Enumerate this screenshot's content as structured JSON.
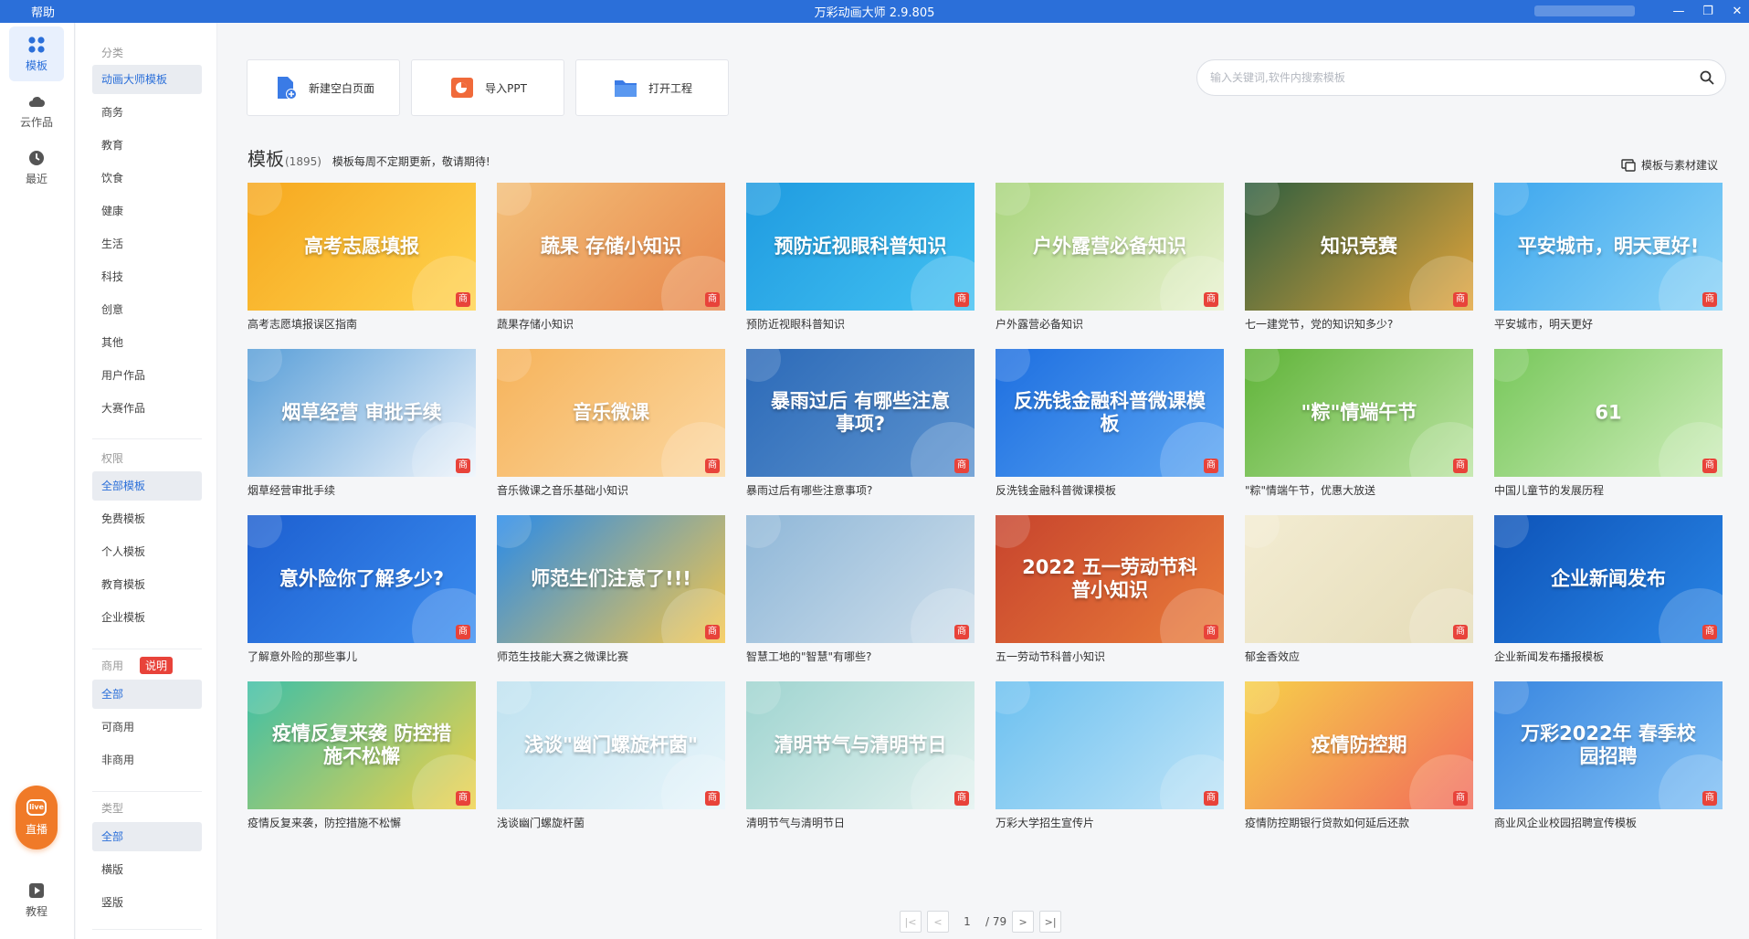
{
  "titlebar": {
    "menu": "帮助",
    "title": "万彩动画大师 2.9.805"
  },
  "rail": {
    "items": [
      {
        "label": "模板",
        "icon": "grid-icon",
        "active": true
      },
      {
        "label": "云作品",
        "icon": "cloud-icon",
        "active": false
      },
      {
        "label": "最近",
        "icon": "clock-icon",
        "active": false
      }
    ],
    "live_label": "直播",
    "live_icon_text": "live",
    "tutorial_label": "教程"
  },
  "filters": {
    "category_head": "分类",
    "categories": [
      "动画大师模板",
      "商务",
      "教育",
      "饮食",
      "健康",
      "生活",
      "科技",
      "创意",
      "其他",
      "用户作品",
      "大赛作品"
    ],
    "permission_head": "权限",
    "permissions": [
      "全部模板",
      "免费模板",
      "个人模板",
      "教育模板",
      "企业模板"
    ],
    "commercial_head": "商用",
    "commercial_note": "说明",
    "commercial": [
      "全部",
      "可商用",
      "非商用"
    ],
    "type_head": "类型",
    "types": [
      "全部",
      "横版",
      "竖版"
    ]
  },
  "actions": {
    "new_blank": "新建空白页面",
    "import_ppt": "导入PPT",
    "open_project": "打开工程"
  },
  "search": {
    "placeholder": "输入关键词,软件内搜索模板"
  },
  "section": {
    "title": "模板",
    "count": "(1895)",
    "tip": "模板每周不定期更新，敬请期待!",
    "suggest": "模板与素材建议"
  },
  "badge_text": "商",
  "templates": [
    {
      "name": "高考志愿填报误区指南",
      "caption": "高考志愿填报",
      "bg": "#f6a81f",
      "bg2": "#ffd34d"
    },
    {
      "name": "蔬果存储小知识",
      "caption": "蔬果 存储小知识",
      "bg": "#f3c07a",
      "bg2": "#e8864a"
    },
    {
      "name": "预防近视眼科普知识",
      "caption": "预防近视眼科普知识",
      "bg": "#1f9be0",
      "bg2": "#43c1f2"
    },
    {
      "name": "户外露营必备知识",
      "caption": "户外露营必备知识",
      "bg": "#a8d47c",
      "bg2": "#e9f2d0"
    },
    {
      "name": "七一建党节，党的知识知多少?",
      "caption": "知识竞赛",
      "bg": "#2f5e3f",
      "bg2": "#e2a43a"
    },
    {
      "name": "平安城市，明天更好",
      "caption": "平安城市，明天更好!",
      "bg": "#3ea7ee",
      "bg2": "#8ad3f7"
    },
    {
      "name": "烟草经营审批手续",
      "caption": "烟草经营 审批手续",
      "bg": "#5a9fd8",
      "bg2": "#eef4fb"
    },
    {
      "name": "音乐微课之音乐基础小知识",
      "caption": "音乐微课",
      "bg": "#f6b35b",
      "bg2": "#fbd7a0"
    },
    {
      "name": "暴雨过后有哪些注意事项?",
      "caption": "暴雨过后 有哪些注意事项?",
      "bg": "#2c6ab8",
      "bg2": "#5c93cf"
    },
    {
      "name": "反洗钱金融科普微课模板",
      "caption": "反洗钱金融科普微课模板",
      "bg": "#1e6fe0",
      "bg2": "#5aa5f3"
    },
    {
      "name": "\"粽\"情端午节，优惠大放送",
      "caption": "\"粽\"情端午节",
      "bg": "#5fb338",
      "bg2": "#bce4a3"
    },
    {
      "name": "中国儿童节的发展历程",
      "caption": "61",
      "bg": "#77c75a",
      "bg2": "#cfeebc"
    },
    {
      "name": "了解意外险的那些事儿",
      "caption": "意外险你了解多少?",
      "bg": "#1d5fd0",
      "bg2": "#3c8ef0"
    },
    {
      "name": "师范生技能大赛之微课比赛",
      "caption": "师范生们注意了!!!",
      "bg": "#2a8be8",
      "bg2": "#f5c64a"
    },
    {
      "name": "智慧工地的\"智慧\"有哪些?",
      "caption": "",
      "bg": "#8fb7d8",
      "bg2": "#cfdfeb"
    },
    {
      "name": "五一劳动节科普小知识",
      "caption": "2022 五一劳动节科普小知识",
      "bg": "#c7442d",
      "bg2": "#e97c3a"
    },
    {
      "name": "郁金香效应",
      "caption": "",
      "bg": "#f3ecd2",
      "bg2": "#e5dcb8"
    },
    {
      "name": "企业新闻发布播报模板",
      "caption": "企业新闻发布",
      "bg": "#0d53b8",
      "bg2": "#2a86e6"
    },
    {
      "name": "疫情反复来袭，防控措施不松懈",
      "caption": "疫情反复来袭 防控措施不松懈",
      "bg": "#3fbfa6",
      "bg2": "#f0d148"
    },
    {
      "name": "浅谈幽门螺旋杆菌",
      "caption": "浅谈\"幽门螺旋杆菌\"",
      "bg": "#bfe2f0",
      "bg2": "#e8f5fa"
    },
    {
      "name": "清明节气与清明节日",
      "caption": "清明节气与清明节日",
      "bg": "#9fd4d0",
      "bg2": "#e3f2ef"
    },
    {
      "name": "万彩大学招生宣传片",
      "caption": "",
      "bg": "#6cc0f0",
      "bg2": "#bfe4f7"
    },
    {
      "name": "疫情防控期银行贷款如何延后还款",
      "caption": "疫情防控期",
      "bg": "#f6d04a",
      "bg2": "#f26a5a"
    },
    {
      "name": "商业风企业校园招聘宣传模板",
      "caption": "万彩2022年 春季校园招聘",
      "bg": "#3a87e0",
      "bg2": "#7fc0f5"
    }
  ],
  "pager": {
    "current": "1",
    "total": "/ 79",
    "first": "|<",
    "prev": "<",
    "next": ">",
    "last": ">|"
  }
}
